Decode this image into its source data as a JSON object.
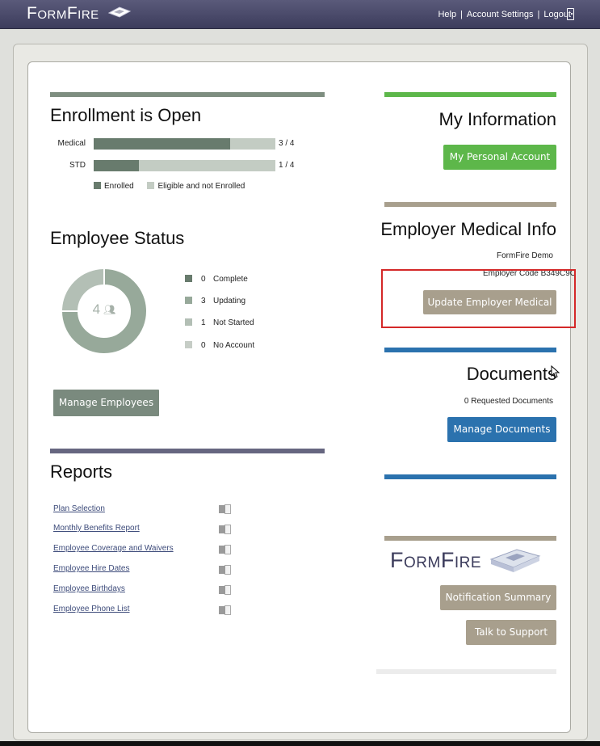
{
  "header": {
    "logo": "FormFire",
    "nav": [
      "Help",
      "Account Settings",
      "Logout"
    ]
  },
  "enrollment": {
    "title": "Enrollment is Open",
    "rows": [
      {
        "label": "Medical",
        "enrolled": 3,
        "eligible": 4,
        "count": "3 / 4"
      },
      {
        "label": "STD",
        "enrolled": 1,
        "eligible": 4,
        "count": "1 / 4"
      }
    ],
    "legend": [
      "Enrolled",
      "Eligible and not Enrolled"
    ]
  },
  "employee_status": {
    "title": "Employee Status",
    "total": "4",
    "rows": [
      {
        "count": "0",
        "label": "Complete",
        "value": 0,
        "color": "#687b6d"
      },
      {
        "count": "3",
        "label": "Updating",
        "value": 3,
        "color": "#97a99a"
      },
      {
        "count": "1",
        "label": "Not Started",
        "value": 1,
        "color": "#b3bfb5"
      },
      {
        "count": "0",
        "label": "No Account",
        "value": 0,
        "color": "#c6cdc6"
      }
    ],
    "manage_label": "Manage Employees"
  },
  "reports": {
    "title": "Reports",
    "items": [
      "Plan Selection",
      "Monthly Benefits Report",
      "Employee Coverage and Waivers",
      "Employee Hire Dates",
      "Employee Birthdays",
      "Employee Phone List"
    ]
  },
  "my_info": {
    "title": "My Information",
    "button": "My Personal Account"
  },
  "employer_medical": {
    "title": "Employer Medical Info",
    "company": "FormFire Demo",
    "code": "Employer Code B349C9C",
    "button": "Update Employer Medical"
  },
  "documents": {
    "title": "Documents",
    "requested": "0 Requested Documents",
    "button": "Manage Documents"
  },
  "support": {
    "logo": "FormFire",
    "notification_button": "Notification Summary",
    "support_button": "Talk to Support"
  },
  "colors": {
    "header": "#4a4a6a",
    "green": "#5db74a",
    "tan": "#a89f8d",
    "blue": "#2b72ae",
    "enrolled": "#687b6d",
    "eligible": "#c3ccc3"
  }
}
